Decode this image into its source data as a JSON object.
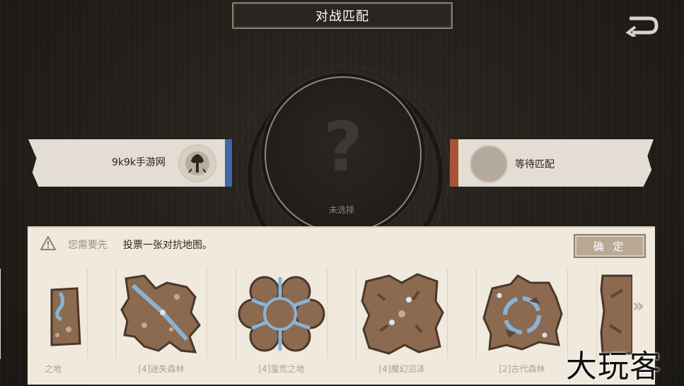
{
  "header": {
    "title": "对战匹配"
  },
  "center": {
    "question_mark": "?",
    "status": "未选择"
  },
  "player_left": {
    "name": "9k9k手游网",
    "accent": "#3f68a8"
  },
  "player_right": {
    "name": "等待匹配",
    "accent": "#a65438"
  },
  "panel": {
    "notice_prefix": "您需要先",
    "notice_main": "投票一张对抗地图。",
    "confirm_label": "确 定"
  },
  "maps": [
    {
      "label": "之地"
    },
    {
      "label": "[4]迷失森林"
    },
    {
      "label": "[4]蛮荒之地"
    },
    {
      "label": "[4]魔幻沼泽"
    },
    {
      "label": "[2]古代森林"
    }
  ],
  "next_icon": "»",
  "watermark": "大玩客"
}
